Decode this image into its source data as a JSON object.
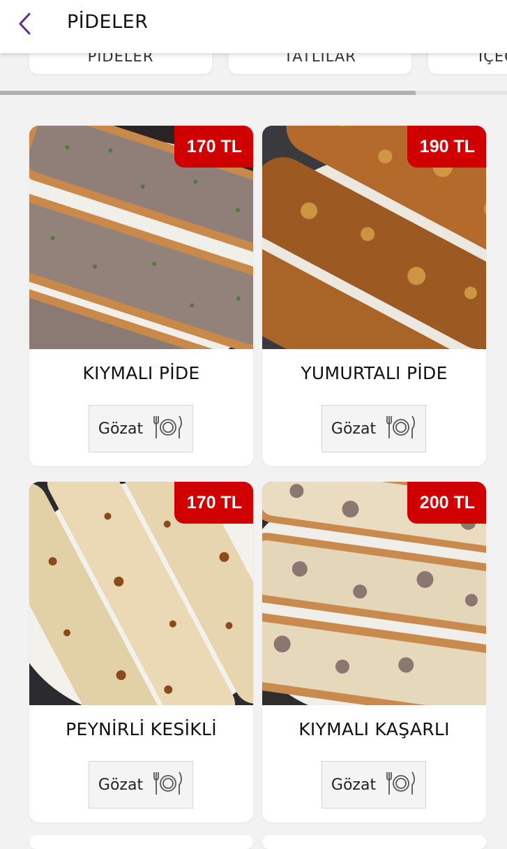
{
  "header": {
    "title": "PİDELER"
  },
  "categories": [
    {
      "label": "PİDELER"
    },
    {
      "label": "TATLILAR"
    },
    {
      "label": "İÇECEKLER"
    }
  ],
  "category_scroll_progress": 0.82,
  "products": [
    {
      "name": "KIYMALI PİDE",
      "price": "170 TL",
      "button_label": "Gözat",
      "image": "minced-meat-pide-photo"
    },
    {
      "name": "YUMURTALI PİDE",
      "price": "190 TL",
      "button_label": "Gözat",
      "image": "egg-pide-photo"
    },
    {
      "name": "PEYNİRLİ KESİKLİ",
      "price": "170 TL",
      "button_label": "Gözat",
      "image": "cheese-pide-photo"
    },
    {
      "name": "KIYMALI KAŞARLI",
      "price": "200 TL",
      "button_label": "Gözat",
      "image": "meat-kashar-pide-photo"
    }
  ],
  "colors": {
    "accent": "#5b2d8e",
    "price_badge": "#d00000",
    "background": "#f2f2f2"
  },
  "icons": {
    "back": "chevron-left-icon",
    "plate": "fork-plate-knife-icon"
  }
}
